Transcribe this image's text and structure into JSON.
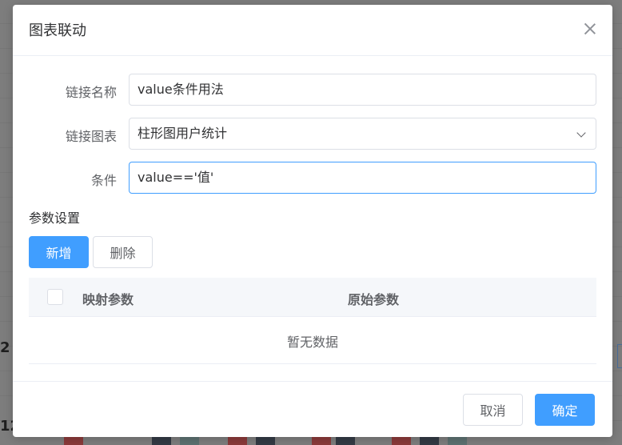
{
  "dialog": {
    "title": "图表联动",
    "close_icon": "close-icon"
  },
  "form": {
    "link_name": {
      "label": "链接名称",
      "value": "value条件用法"
    },
    "link_chart": {
      "label": "链接图表",
      "value": "柱形图用户统计"
    },
    "condition": {
      "label": "条件",
      "value": "value=='值'"
    }
  },
  "params": {
    "section_title": "参数设置",
    "add_label": "新增",
    "delete_label": "删除",
    "columns": [
      "映射参数",
      "原始参数"
    ],
    "empty_text": "暂无数据"
  },
  "footer": {
    "cancel_label": "取消",
    "confirm_label": "确定"
  },
  "colors": {
    "primary": "#409eff",
    "border": "#dcdfe6",
    "overlay": "#7f7f7f"
  }
}
